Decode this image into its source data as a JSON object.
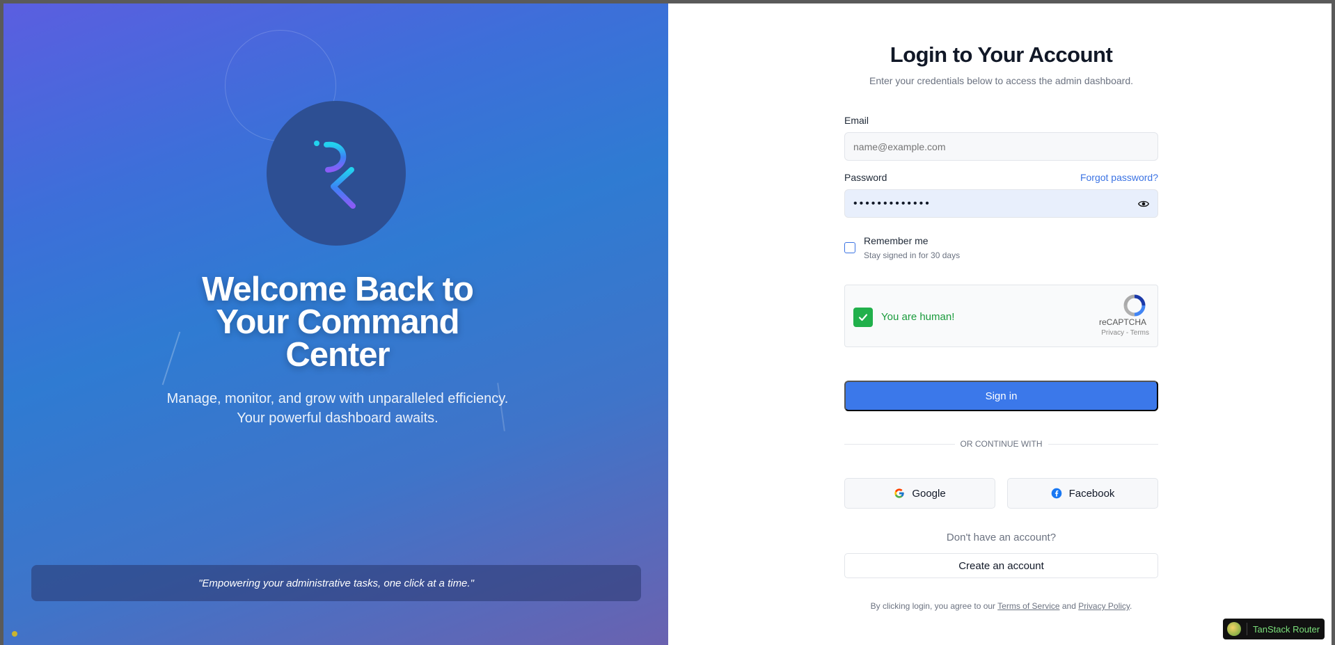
{
  "hero": {
    "title": "Welcome Back to Your Command Center",
    "subtitle": "Manage, monitor, and grow with unparalleled efficiency. Your powerful dashboard awaits.",
    "quote": "\"Empowering your administrative tasks, one click at a time.\""
  },
  "form": {
    "title": "Login to Your Account",
    "subtitle": "Enter your credentials below to access the admin dashboard.",
    "email_label": "Email",
    "email_placeholder": "name@example.com",
    "password_label": "Password",
    "password_value": "•••••••••••••",
    "forgot_password": "Forgot password?",
    "remember_label": "Remember me",
    "remember_sub": "Stay signed in for 30 days",
    "captcha_text": "You are human!",
    "captcha_brand": "reCAPTCHA",
    "captcha_privacy": "Privacy",
    "captcha_terms": "Terms",
    "signin_label": "Sign in",
    "divider_text": "OR CONTINUE WITH",
    "google_label": "Google",
    "facebook_label": "Facebook",
    "no_account": "Don't have an account?",
    "create_account": "Create an account",
    "legal_prefix": "By clicking login, you agree to our",
    "terms_link": "Terms of Service",
    "legal_and": "and",
    "privacy_link": "Privacy Policy",
    "legal_suffix": "."
  },
  "devtools": {
    "label": "TanStack Router"
  },
  "colors": {
    "accent": "#3b78ea",
    "success": "#21b04b",
    "hero_start": "#5b5ee0",
    "hero_end": "#6a62b0"
  }
}
